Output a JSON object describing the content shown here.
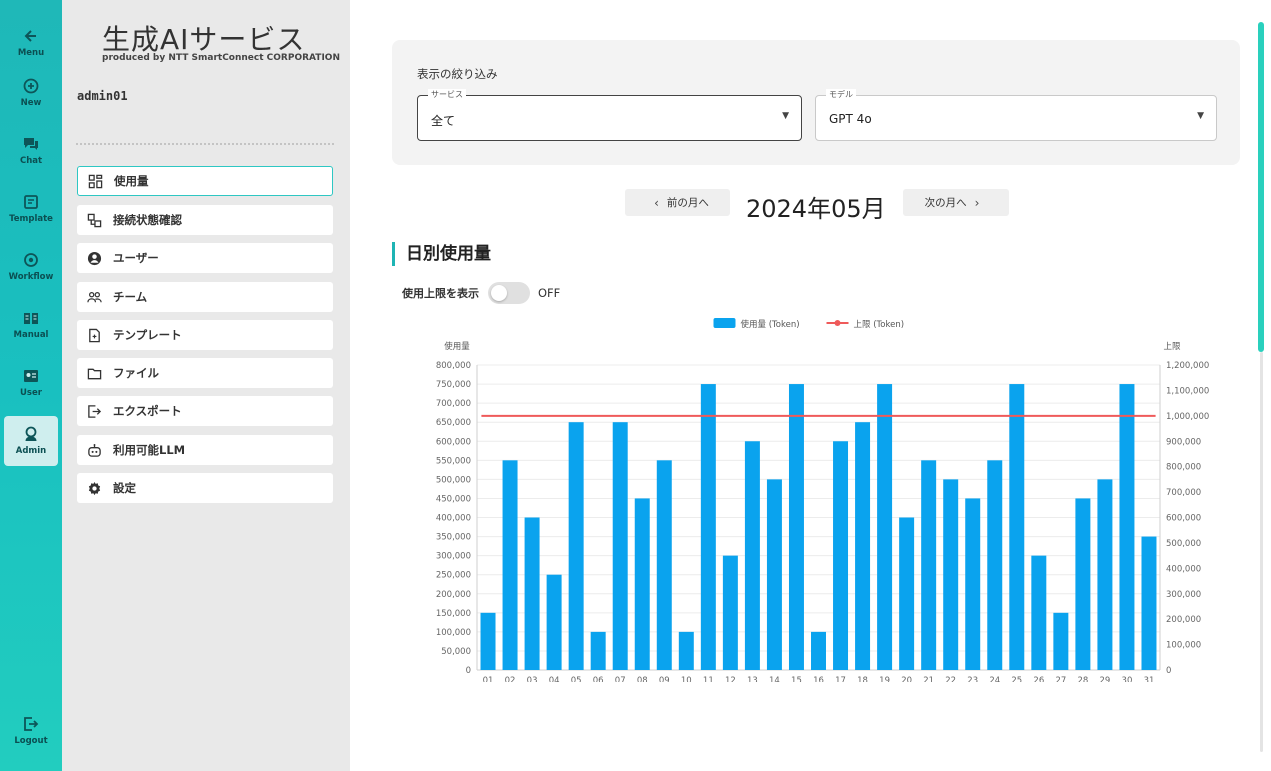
{
  "rail": {
    "items": [
      {
        "label": "Menu",
        "icon": "arrow-left-icon"
      },
      {
        "label": "New",
        "icon": "plus-circle-icon"
      },
      {
        "label": "Chat",
        "icon": "chat-icon"
      },
      {
        "label": "Template",
        "icon": "template-icon"
      },
      {
        "label": "Workflow",
        "icon": "workflow-icon"
      },
      {
        "label": "Manual",
        "icon": "book-icon"
      },
      {
        "label": "User",
        "icon": "user-card-icon"
      },
      {
        "label": "Admin",
        "icon": "admin-icon"
      }
    ],
    "logout": "Logout"
  },
  "brand": {
    "title": "生成AIサービス",
    "subtitle": "produced by NTT SmartConnect CORPORATION"
  },
  "user": {
    "name": "admin01"
  },
  "menu": {
    "items": [
      {
        "label": "使用量",
        "icon": "usage-icon"
      },
      {
        "label": "接続状態確認",
        "icon": "connection-icon"
      },
      {
        "label": "ユーザー",
        "icon": "user-icon"
      },
      {
        "label": "チーム",
        "icon": "team-icon"
      },
      {
        "label": "テンプレート",
        "icon": "template-doc-icon"
      },
      {
        "label": "ファイル",
        "icon": "folder-icon"
      },
      {
        "label": "エクスポート",
        "icon": "export-icon"
      },
      {
        "label": "利用可能LLM",
        "icon": "robot-icon"
      },
      {
        "label": "設定",
        "icon": "gear-icon"
      }
    ],
    "active_index": 0
  },
  "filter": {
    "title": "表示の絞り込み",
    "service": {
      "legend": "サービス",
      "value": "全て"
    },
    "model": {
      "legend": "モデル",
      "value": "GPT 4o"
    }
  },
  "month_nav": {
    "prev_label": "前の月へ",
    "next_label": "次の月へ",
    "current": "2024年05月"
  },
  "section": {
    "title": "日別使用量",
    "toggle_label": "使用上限を表示",
    "toggle_state": "OFF"
  },
  "colors": {
    "accent": "#1eb4b4",
    "bar": "#0aa3ee",
    "limit_line": "#ef5a5a"
  },
  "chart_data": {
    "type": "bar",
    "legend": [
      "使用量 (Token)",
      "上限 (Token)"
    ],
    "legend_position": "top-center",
    "ylabel": "使用量",
    "y2label": "上限",
    "ylim": [
      0,
      800000
    ],
    "y2lim": [
      0,
      1200000
    ],
    "yticks": [
      "0",
      "50,000",
      "100,000",
      "150,000",
      "200,000",
      "250,000",
      "300,000",
      "350,000",
      "400,000",
      "450,000",
      "500,000",
      "550,000",
      "600,000",
      "650,000",
      "700,000",
      "750,000",
      "800,000"
    ],
    "y2ticks": [
      "0",
      "100,000",
      "200,000",
      "300,000",
      "400,000",
      "500,000",
      "600,000",
      "700,000",
      "800,000",
      "900,000",
      "1,000,000",
      "1,100,000",
      "1,200,000"
    ],
    "categories": [
      "01",
      "02",
      "03",
      "04",
      "05",
      "06",
      "07",
      "08",
      "09",
      "10",
      "11",
      "12",
      "13",
      "14",
      "15",
      "16",
      "17",
      "18",
      "19",
      "20",
      "21",
      "22",
      "23",
      "24",
      "25",
      "26",
      "27",
      "28",
      "29",
      "30",
      "31"
    ],
    "series": [
      {
        "name": "使用量 (Token)",
        "axis": "left",
        "values": [
          150000,
          550000,
          400000,
          250000,
          650000,
          100000,
          650000,
          450000,
          550000,
          100000,
          750000,
          300000,
          600000,
          500000,
          750000,
          100000,
          600000,
          650000,
          750000,
          400000,
          550000,
          500000,
          450000,
          550000,
          750000,
          300000,
          150000,
          450000,
          500000,
          750000,
          350000
        ]
      },
      {
        "name": "上限 (Token)",
        "axis": "right",
        "type": "line",
        "value": 1000000
      }
    ],
    "grid": true
  }
}
